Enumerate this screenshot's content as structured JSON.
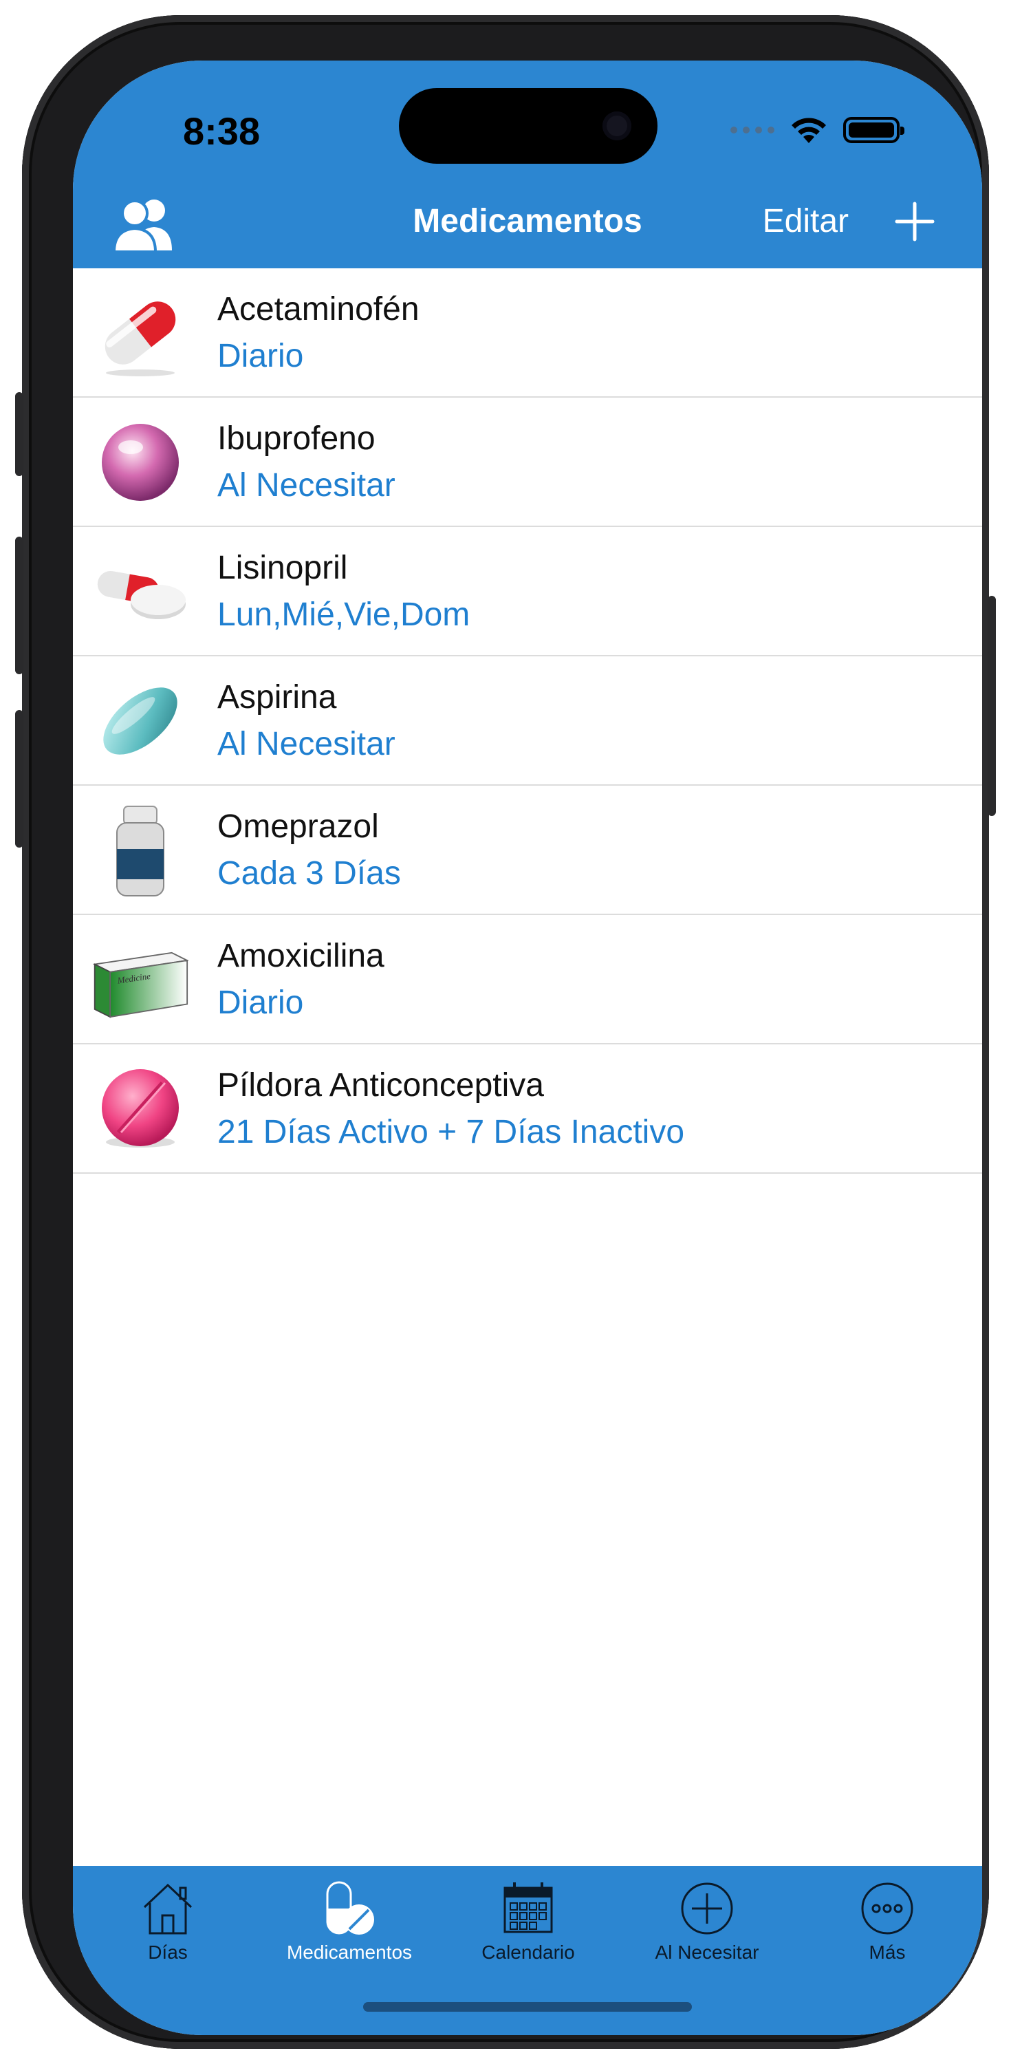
{
  "status": {
    "time": "8:38"
  },
  "nav": {
    "title": "Medicamentos",
    "edit_label": "Editar"
  },
  "medications": [
    {
      "name": "Acetaminofén",
      "schedule": "Diario",
      "icon": "capsule-red-white-icon"
    },
    {
      "name": "Ibuprofeno",
      "schedule": "Al Necesitar",
      "icon": "pink-pearl-pill-icon"
    },
    {
      "name": "Lisinopril",
      "schedule": "Lun,Mié,Vie,Dom",
      "icon": "capsule-and-tablet-icon"
    },
    {
      "name": "Aspirina",
      "schedule": "Al Necesitar",
      "icon": "teal-oval-tablet-icon"
    },
    {
      "name": "Omeprazol",
      "schedule": "Cada 3 Días",
      "icon": "medicine-bottle-icon"
    },
    {
      "name": "Amoxicilina",
      "schedule": "Diario",
      "icon": "medicine-box-icon",
      "box_text": "Medicine"
    },
    {
      "name": "Píldora Anticonceptiva",
      "schedule": "21 Días Activo + 7 Días Inactivo",
      "icon": "pink-round-tablet-icon"
    }
  ],
  "tabs": [
    {
      "label": "Días",
      "icon": "house-icon"
    },
    {
      "label": "Medicamentos",
      "icon": "pills-icon",
      "active": true
    },
    {
      "label": "Calendario",
      "icon": "calendar-icon"
    },
    {
      "label": "Al Necesitar",
      "icon": "plus-circle-icon"
    },
    {
      "label": "Más",
      "icon": "more-circle-icon"
    }
  ],
  "colors": {
    "accent": "#2c86d1",
    "schedule_text": "#1f7fd0"
  }
}
